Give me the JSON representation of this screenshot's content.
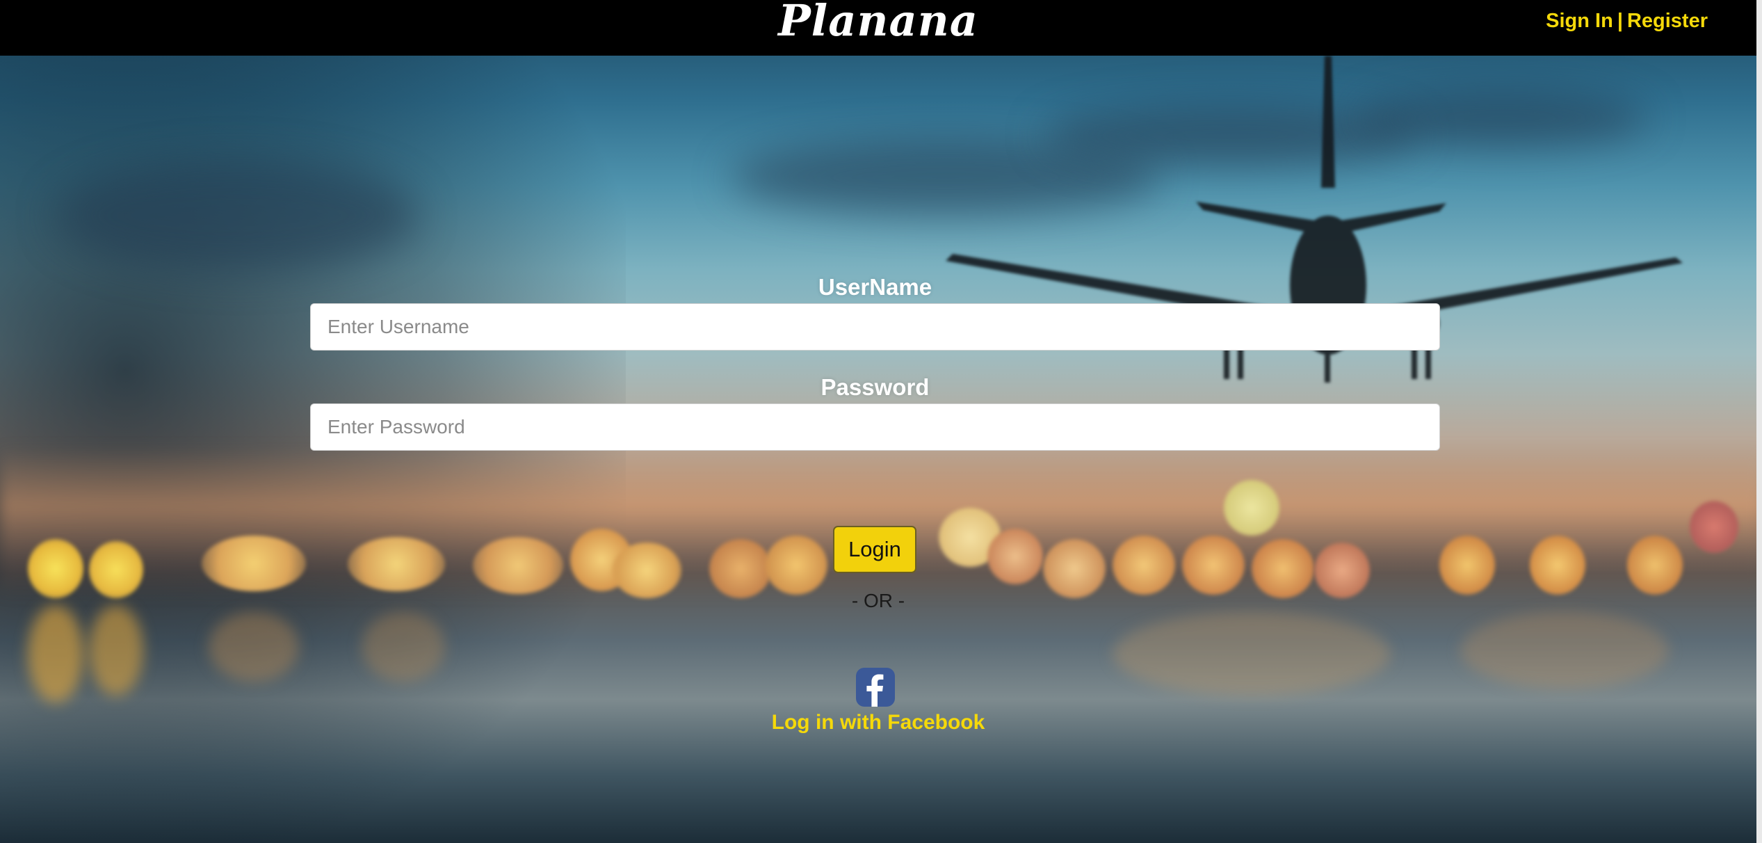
{
  "header": {
    "brand": "Planana",
    "sign_in": "Sign In",
    "separator": "|",
    "register": "Register"
  },
  "form": {
    "username_label": "UserName",
    "username_placeholder": "Enter Username",
    "username_value": "",
    "password_label": "Password",
    "password_placeholder": "Enter Password",
    "password_value": "",
    "login_button": "Login",
    "or_text": "- OR -",
    "facebook_icon": "facebook-icon",
    "facebook_link": "Log in with Facebook"
  },
  "colors": {
    "accent_yellow": "#f5d90a",
    "navbar": "#000000",
    "facebook_blue": "#3b5998"
  }
}
